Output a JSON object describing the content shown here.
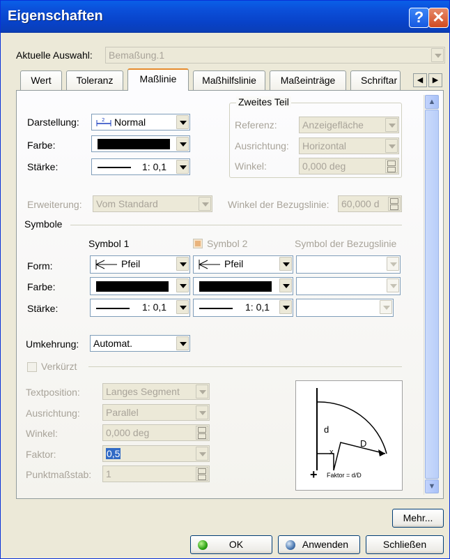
{
  "window": {
    "title": "Eigenschaften",
    "help_glyph": "?",
    "close_glyph": "✕"
  },
  "selection": {
    "label": "Aktuelle Auswahl:",
    "value": "Bemaßung.1"
  },
  "tabs": [
    {
      "label": "Wert"
    },
    {
      "label": "Toleranz"
    },
    {
      "label": "Maßlinie"
    },
    {
      "label": "Maßhilfslinie"
    },
    {
      "label": "Maßeinträge"
    },
    {
      "label": "Schriftar"
    }
  ],
  "tab_scroll": {
    "left": "◀",
    "right": "▶"
  },
  "main": {
    "darstellung": {
      "label": "Darstellung:",
      "value": "Normal"
    },
    "farbe": {
      "label": "Farbe:"
    },
    "staerke": {
      "label": "Stärke:",
      "value": "1: 0,1"
    }
  },
  "zweites_teil": {
    "title": "Zweites Teil",
    "referenz": {
      "label": "Referenz:",
      "value": "Anzeigefläche"
    },
    "ausrichtung": {
      "label": "Ausrichtung:",
      "value": "Horizontal"
    },
    "winkel": {
      "label": "Winkel:",
      "value": "0,000 deg"
    }
  },
  "erweiterung": {
    "label": "Erweiterung:",
    "value": "Vom Standard"
  },
  "winkel_bezugslinie": {
    "label": "Winkel der Bezugslinie:",
    "value": "60,000 d"
  },
  "symbole": {
    "title": "Symbole",
    "col1": "Symbol 1",
    "col2": "Symbol 2",
    "col3": "Symbol der Bezugslinie",
    "form_label": "Form:",
    "farbe_label": "Farbe:",
    "staerke_label": "Stärke:",
    "symbol1": {
      "form": "Pfeil",
      "staerke": "1: 0,1"
    },
    "symbol2": {
      "form": "Pfeil",
      "staerke": "1: 0,1"
    }
  },
  "umkehrung": {
    "label": "Umkehrung:",
    "value": "Automat."
  },
  "verkuerzt": {
    "label": "Verkürzt",
    "textposition": {
      "label": "Textposition:",
      "value": "Langes Segment"
    },
    "ausrichtung": {
      "label": "Ausrichtung:",
      "value": "Parallel"
    },
    "winkel": {
      "label": "Winkel:",
      "value": "0,000 deg"
    },
    "faktor": {
      "label": "Faktor:",
      "value": "0,5"
    },
    "punktmassstab": {
      "label": "Punktmaßstab:",
      "value": "1"
    }
  },
  "diagram": {
    "d": "d",
    "D": "D",
    "x": "x",
    "faktor_text": "Faktor = d/D",
    "plus": "+"
  },
  "buttons": {
    "mehr": "Mehr...",
    "ok": "OK",
    "anwenden": "Anwenden",
    "schliessen": "Schließen"
  },
  "colors": {
    "title_bar": "#0A5FE8",
    "active_tab_accent": "#E68B2C",
    "selection": "#316AC5"
  }
}
